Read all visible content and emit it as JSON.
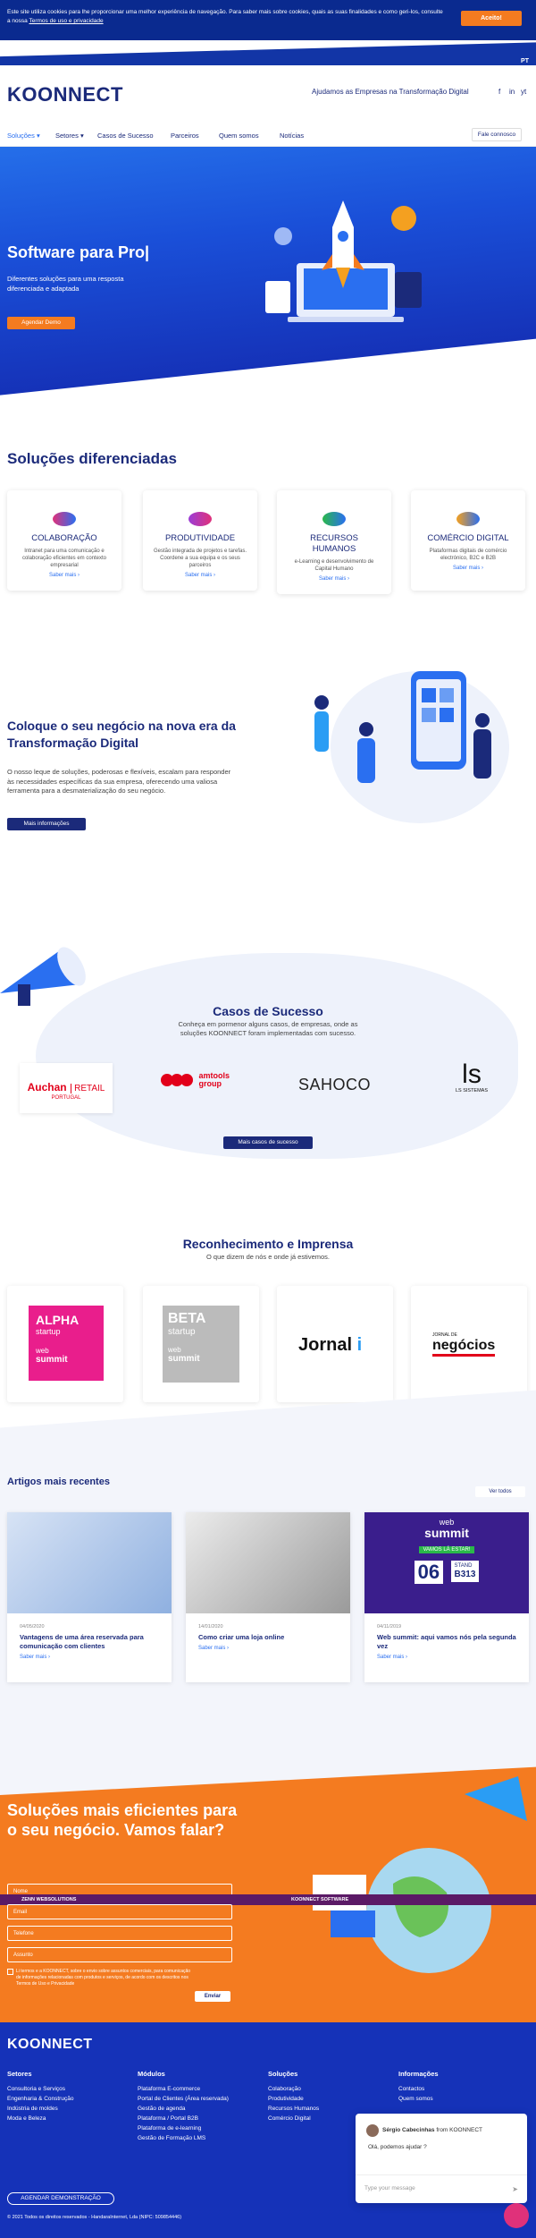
{
  "cookie": {
    "text": "Este site utiliza cookies para lhe proporcionar uma melhor experiência de navegação. Para saber mais sobre cookies, quais as suas finalidades e como geri-los, consulte a nossa",
    "link": "Termos de uso e privacidade",
    "accept": "Aceito!"
  },
  "lang": "PT",
  "header": {
    "logo": "KOONNECT",
    "tagline": "Ajudamos as Empresas na Transformação Digital",
    "social": [
      "f",
      "in",
      "yt"
    ]
  },
  "nav": {
    "items": [
      "Soluções",
      "Setores",
      "Casos de Sucesso",
      "Parceiros",
      "Quem somos",
      "Notícias"
    ],
    "contact": "Fale connosco"
  },
  "hero": {
    "title": "Software para Pro|",
    "subtitle": "Diferentes soluções para uma resposta diferenciada e adaptada",
    "cta": "Agendar Demo"
  },
  "solutions": {
    "title": "Soluções diferenciadas",
    "cards": [
      {
        "title": "COLABORAÇÃO",
        "desc": "Intranet para uma comunicação e colaboração eficientes em contexto empresarial",
        "more": "Saber mais"
      },
      {
        "title": "PRODUTIVIDADE",
        "desc": "Gestão integrada de projetos e tarefas. Coordene a sua equipa e os seus parceiros",
        "more": "Saber mais"
      },
      {
        "title": "RECURSOS HUMANOS",
        "desc": "e-Learning e desenvolvimento de Capital Humano",
        "more": "Saber mais"
      },
      {
        "title": "COMÉRCIO DIGITAL",
        "desc": "Plataformas digitais de comércio electrónico, B2C e B2B",
        "more": "Saber mais"
      }
    ],
    "colors": [
      "#e0317a",
      "#9b3dd6",
      "#2ab84a",
      "#f4a020"
    ]
  },
  "transform": {
    "title": "Coloque o seu negócio na nova era da Transformação Digital",
    "text": "O nosso leque de soluções, poderosas e flexíveis, escalam para responder às necessidades específicas da sua empresa, oferecendo uma valiosa ferramenta para a desmaterialização do seu negócio.",
    "button": "Mais informações"
  },
  "cases": {
    "title": "Casos de Sucesso",
    "text": "Conheça em pormenor alguns casos, de empresas, onde as soluções KOONNECT foram implementadas com sucesso.",
    "logos": [
      {
        "main": "Auchan",
        "sub": "RETAIL",
        "foot": "PORTUGAL"
      },
      {
        "main": "amtools",
        "sub": "group"
      },
      {
        "main": "SAHOCO"
      },
      {
        "main": "ls",
        "sub": "LS SISTEMAS"
      }
    ],
    "button": "Mais casos de sucesso"
  },
  "press": {
    "title": "Reconhecimento e Imprensa",
    "text": "O que dizem de nós e onde já estivemos.",
    "items": [
      {
        "a": "ALPHA",
        "b": "startup",
        "c": "web",
        "d": "summit"
      },
      {
        "a": "BETA",
        "b": "startup",
        "c": "web",
        "d": "summit"
      },
      {
        "a": "Jornal"
      },
      {
        "a": "JORNAL DE",
        "b": "negócios"
      }
    ]
  },
  "articles": {
    "title": "Artigos mais recentes",
    "all": "Ver todos",
    "items": [
      {
        "date": "04/05/2020",
        "title": "Vantagens de uma área reservada para comunicação com clientes",
        "more": "Saber mais"
      },
      {
        "date": "14/01/2020",
        "title": "Como criar uma loja online",
        "more": "Saber mais"
      },
      {
        "date": "04/11/2019",
        "title": "Web summit: aqui vamos nós pela segunda vez",
        "more": "Saber mais"
      }
    ],
    "ws": {
      "a": "web",
      "b": "summit",
      "c": "VAMOS LÁ ESTAR!",
      "d": "06",
      "e": "STAND",
      "f": "B313"
    }
  },
  "contact": {
    "title": "Soluções mais eficientes para o seu negócio. Vamos falar?",
    "fields": [
      "Nome",
      "Email",
      "Telefone",
      "Assunto"
    ],
    "consent": "Li termos e a KOONNECT, sobre o envio sobre assuntos comerciais, para comunicação de informações relacionadas com produtos e serviços, de acordo com os descritos nos Termos de Uso e Privacidade",
    "send": "Enviar",
    "strip_left": "ZENN WEBSOLUTIONS",
    "strip_right": "KOONNECT SOFTWARE"
  },
  "footer": {
    "logo": "KOONNECT",
    "columns": [
      {
        "title": "Setores",
        "items": [
          "Consultoria e Serviços",
          "Engenharia & Construção",
          "Indústria de moldes",
          "Moda e Beleza"
        ]
      },
      {
        "title": "Módulos",
        "items": [
          "Plataforma E-commerce",
          "Portal de Clientes (Área reservada)",
          "Gestão de agenda",
          "Plataforma / Portal B2B",
          "Plataforma de e-learning",
          "Gestão de Formação LMS"
        ]
      },
      {
        "title": "Soluções",
        "items": [
          "Colaboração",
          "Produtividade",
          "Recursos Humanos",
          "Comércio Digital"
        ]
      },
      {
        "title": "Informações",
        "items": [
          "Contactos",
          "Quem somos"
        ]
      }
    ],
    "demo": "AGENDAR DEMONSTRAÇÃO",
    "copyright": "© 2021 Todos os direitos reservados - HandaraInternet, Lda (NIPC: 509854446)"
  },
  "chat": {
    "from": "Sérgio Cabecinhas",
    "from_suffix": "from KOONNECT",
    "message": "Olá, podemos ajudar ?",
    "placeholder": "Type your message"
  }
}
